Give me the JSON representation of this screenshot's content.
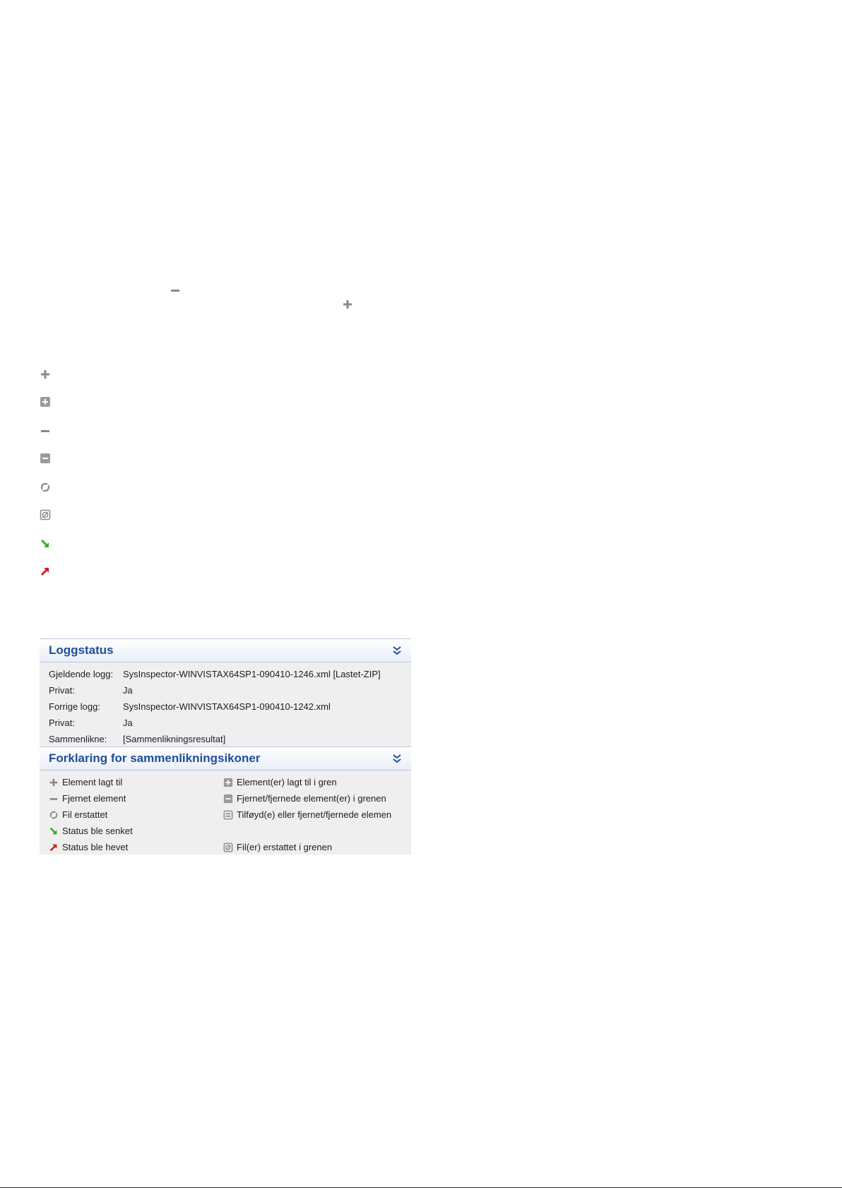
{
  "panel": {
    "sections": [
      {
        "title": "Loggstatus",
        "rows": [
          {
            "key": "Gjeldende logg:",
            "value": "SysInspector-WINVISTAX64SP1-090410-1246.xml [Lastet-ZIP]"
          },
          {
            "key": "Privat:",
            "value": "Ja"
          },
          {
            "key": "Forrige logg:",
            "value": "SysInspector-WINVISTAX64SP1-090410-1242.xml"
          },
          {
            "key": "Privat:",
            "value": "Ja"
          },
          {
            "key": "Sammenlikne:",
            "value": "[Sammenlikningsresultat]"
          }
        ]
      },
      {
        "title": "Forklaring for sammenlikningsikoner",
        "legend_left": [
          {
            "icon": "plus-icon",
            "label": "Element lagt til"
          },
          {
            "icon": "minus-icon",
            "label": "Fjernet element"
          },
          {
            "icon": "file-replaced-icon",
            "label": "Fil erstattet"
          },
          {
            "icon": "status-lowered-icon",
            "label": "Status ble senket"
          },
          {
            "icon": "status-raised-icon",
            "label": "Status ble hevet"
          }
        ],
        "legend_right": [
          {
            "icon": "boxed-plus-icon",
            "label": "Element(er) lagt til i gren"
          },
          {
            "icon": "boxed-minus-icon",
            "label": "Fjernet/fjernede element(er) i grenen"
          },
          {
            "icon": "boxed-added-removed-icon",
            "label": "Tilføyd(e) eller fjernet/fjernede elemen"
          },
          {
            "icon": "boxed-file-replaced-icon",
            "label": "Fil(er) erstattet i grenen"
          }
        ]
      }
    ]
  },
  "icon_colors": {
    "gray": "#8a8a8a",
    "green": "#3fa82a",
    "red": "#d21f1f",
    "header_blue": "#1f4e9a"
  }
}
